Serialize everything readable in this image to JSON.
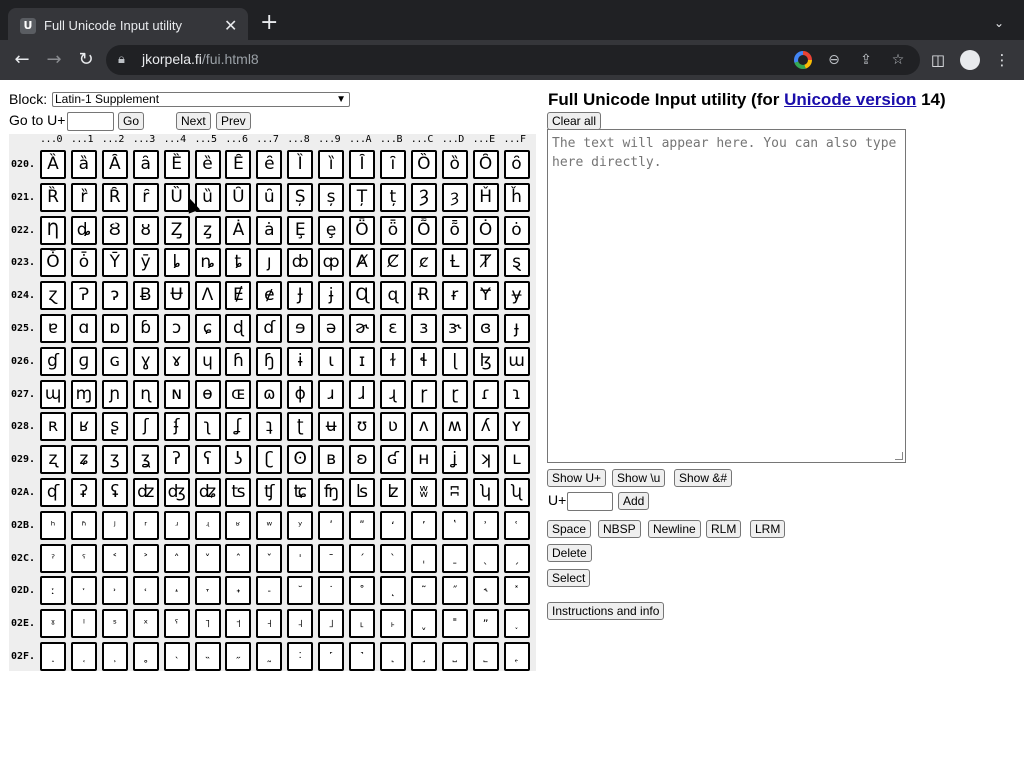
{
  "browser": {
    "tab_title": "Full Unicode Input utility",
    "url_host": "jkorpela.fi",
    "url_path": "/fui.html8"
  },
  "controls": {
    "block_label": "Block:",
    "block_value": "Latin-1 Supplement",
    "goto_label": "Go to U+",
    "goto_value": "",
    "go_button": "Go",
    "next_button": "Next",
    "prev_button": "Prev"
  },
  "grid": {
    "col_headers": [
      "...0",
      "...1",
      "...2",
      "...3",
      "...4",
      "...5",
      "...6",
      "...7",
      "...8",
      "...9",
      "...A",
      "...B",
      "...C",
      "...D",
      "...E",
      "...F"
    ],
    "rows": [
      {
        "label": "020.",
        "chars": [
          "Ȁ",
          "ȁ",
          "Ȃ",
          "ȃ",
          "Ȅ",
          "ȅ",
          "Ȇ",
          "ȇ",
          "Ȉ",
          "ȉ",
          "Ȋ",
          "ȋ",
          "Ȍ",
          "ȍ",
          "Ȏ",
          "ȏ"
        ]
      },
      {
        "label": "021.",
        "chars": [
          "Ȑ",
          "ȑ",
          "Ȓ",
          "ȓ",
          "Ȕ",
          "ȕ",
          "Ȗ",
          "ȗ",
          "Ș",
          "ș",
          "Ț",
          "ț",
          "Ȝ",
          "ȝ",
          "Ȟ",
          "ȟ"
        ]
      },
      {
        "label": "022.",
        "chars": [
          "Ƞ",
          "ȡ",
          "Ȣ",
          "ȣ",
          "Ȥ",
          "ȥ",
          "Ȧ",
          "ȧ",
          "Ȩ",
          "ȩ",
          "Ȫ",
          "ȫ",
          "Ȭ",
          "ȭ",
          "Ȯ",
          "ȯ"
        ]
      },
      {
        "label": "023.",
        "chars": [
          "Ȱ",
          "ȱ",
          "Ȳ",
          "ȳ",
          "ȴ",
          "ȵ",
          "ȶ",
          "ȷ",
          "ȸ",
          "ȹ",
          "Ⱥ",
          "Ȼ",
          "ȼ",
          "Ƚ",
          "Ⱦ",
          "ȿ"
        ]
      },
      {
        "label": "024.",
        "chars": [
          "ɀ",
          "Ɂ",
          "ɂ",
          "Ƀ",
          "Ʉ",
          "Ʌ",
          "Ɇ",
          "ɇ",
          "Ɉ",
          "ɉ",
          "Ɋ",
          "ɋ",
          "Ɍ",
          "ɍ",
          "Ɏ",
          "ɏ"
        ]
      },
      {
        "label": "025.",
        "chars": [
          "ɐ",
          "ɑ",
          "ɒ",
          "ɓ",
          "ɔ",
          "ɕ",
          "ɖ",
          "ɗ",
          "ɘ",
          "ə",
          "ɚ",
          "ɛ",
          "ɜ",
          "ɝ",
          "ɞ",
          "ɟ"
        ]
      },
      {
        "label": "026.",
        "chars": [
          "ɠ",
          "ɡ",
          "ɢ",
          "ɣ",
          "ɤ",
          "ɥ",
          "ɦ",
          "ɧ",
          "ɨ",
          "ɩ",
          "ɪ",
          "ɫ",
          "ɬ",
          "ɭ",
          "ɮ",
          "ɯ"
        ]
      },
      {
        "label": "027.",
        "chars": [
          "ɰ",
          "ɱ",
          "ɲ",
          "ɳ",
          "ɴ",
          "ɵ",
          "ɶ",
          "ɷ",
          "ɸ",
          "ɹ",
          "ɺ",
          "ɻ",
          "ɼ",
          "ɽ",
          "ɾ",
          "ɿ"
        ]
      },
      {
        "label": "028.",
        "chars": [
          "ʀ",
          "ʁ",
          "ʂ",
          "ʃ",
          "ʄ",
          "ʅ",
          "ʆ",
          "ʇ",
          "ʈ",
          "ʉ",
          "ʊ",
          "ʋ",
          "ʌ",
          "ʍ",
          "ʎ",
          "ʏ"
        ]
      },
      {
        "label": "029.",
        "chars": [
          "ʐ",
          "ʑ",
          "ʒ",
          "ʓ",
          "ʔ",
          "ʕ",
          "ʖ",
          "ʗ",
          "ʘ",
          "ʙ",
          "ʚ",
          "ʛ",
          "ʜ",
          "ʝ",
          "ʞ",
          "ʟ"
        ]
      },
      {
        "label": "02A.",
        "chars": [
          "ʠ",
          "ʡ",
          "ʢ",
          "ʣ",
          "ʤ",
          "ʥ",
          "ʦ",
          "ʧ",
          "ʨ",
          "ʩ",
          "ʪ",
          "ʫ",
          "ʬ",
          "ʭ",
          "ʮ",
          "ʯ"
        ]
      },
      {
        "label": "02B.",
        "chars": [
          "ʰ",
          "ʱ",
          "ʲ",
          "ʳ",
          "ʴ",
          "ʵ",
          "ʶ",
          "ʷ",
          "ʸ",
          "ʹ",
          "ʺ",
          "ʻ",
          "ʼ",
          "ʽ",
          "ʾ",
          "ʿ"
        ]
      },
      {
        "label": "02C.",
        "chars": [
          "ˀ",
          "ˁ",
          "˂",
          "˃",
          "˄",
          "˅",
          "ˆ",
          "ˇ",
          "ˈ",
          "ˉ",
          "ˊ",
          "ˋ",
          "ˌ",
          "ˍ",
          "ˎ",
          "ˏ"
        ]
      },
      {
        "label": "02D.",
        "chars": [
          "ː",
          "ˑ",
          "˒",
          "˓",
          "˔",
          "˕",
          "˖",
          "˗",
          "˘",
          "˙",
          "˚",
          "˛",
          "˜",
          "˝",
          "˞",
          "˟"
        ]
      },
      {
        "label": "02E.",
        "chars": [
          "ˠ",
          "ˡ",
          "ˢ",
          "ˣ",
          "ˤ",
          "˥",
          "˦",
          "˧",
          "˨",
          "˩",
          "˪",
          "˫",
          "ˬ",
          "˭",
          "ˮ",
          "˯"
        ]
      },
      {
        "label": "02F.",
        "chars": [
          "˰",
          "˱",
          "˲",
          "˳",
          "˴",
          "˵",
          "˶",
          "˷",
          "˸",
          "˹",
          "˺",
          "˻",
          "˼",
          "˽",
          "˾",
          "˿"
        ]
      }
    ]
  },
  "panel": {
    "heading_prefix": "Full Unicode Input utility (for ",
    "heading_link": "Unicode version",
    "heading_suffix": " 14)",
    "clear_all": "Clear all",
    "textarea_placeholder": "The text will appear here. You can also type here directly.",
    "show_uplus": "Show U+",
    "show_u": "Show \\u",
    "show_amp": "Show &#",
    "uplus_label": "U+",
    "uplus_value": "",
    "add": "Add",
    "space": "Space",
    "nbsp": "NBSP",
    "newline": "Newline",
    "rlm": "RLM",
    "lrm": "LRM",
    "delete": "Delete",
    "select": "Select",
    "instructions": "Instructions and info"
  },
  "icons": {
    "back": "arrow-left-icon",
    "forward": "arrow-right-icon",
    "reload": "reload-icon",
    "lock": "lock-icon",
    "google": "google-icon",
    "zoom": "zoom-out-icon",
    "share": "share-icon",
    "star": "star-icon",
    "sidepanel": "side-panel-icon",
    "profile": "profile-icon",
    "menu": "kebab-menu-icon"
  }
}
